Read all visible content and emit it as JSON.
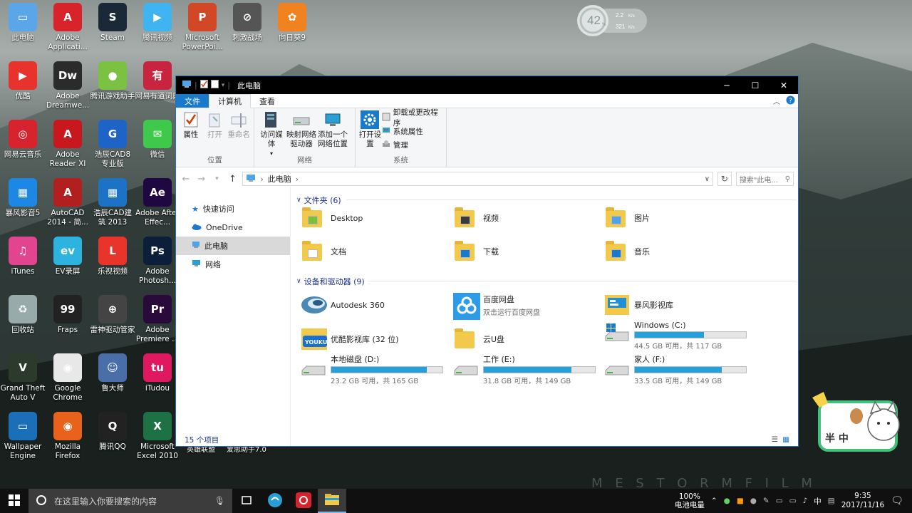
{
  "desktop": {
    "icons": [
      {
        "label": "此电脑"
      },
      {
        "label": "Adobe Applicati..."
      },
      {
        "label": "Steam"
      },
      {
        "label": "腾讯视频"
      },
      {
        "label": "Microsoft PowerPoi..."
      },
      {
        "label": "刺激战场"
      },
      {
        "label": "向日葵9"
      },
      {
        "label": "优酷"
      },
      {
        "label": "Adobe Dreamwe..."
      },
      {
        "label": "腾讯游戏助手"
      },
      {
        "label": "网易有道词典"
      },
      {
        "label": "网易云音乐"
      },
      {
        "label": "Adobe Reader XI"
      },
      {
        "label": "浩辰CAD8 专业版"
      },
      {
        "label": "微信"
      },
      {
        "label": "暴风影音5"
      },
      {
        "label": "AutoCAD 2014 - 简..."
      },
      {
        "label": "浩辰CAD建筑 2013"
      },
      {
        "label": "Adobe After Effec..."
      },
      {
        "label": "iTunes"
      },
      {
        "label": "EV录屏"
      },
      {
        "label": "乐视视频"
      },
      {
        "label": "Adobe Photosh..."
      },
      {
        "label": "回收站"
      },
      {
        "label": "Fraps"
      },
      {
        "label": "雷神驱动管家"
      },
      {
        "label": "Adobe Premiere ..."
      },
      {
        "label": "Grand Theft Auto V"
      },
      {
        "label": "Google Chrome"
      },
      {
        "label": "鲁大师"
      },
      {
        "label": "iTudou"
      },
      {
        "label": "Wallpaper Engine"
      },
      {
        "label": "Mozilla Firefox"
      },
      {
        "label": "腾讯QQ"
      },
      {
        "label": "Microsoft Excel 2010"
      }
    ],
    "hidden_labels": [
      "英雄联盟",
      "爱思助手7.0"
    ],
    "widget": {
      "cpu": "42",
      "cpu_unit": "%",
      "up": "2.2",
      "up_unit": "K/s",
      "down": "321",
      "down_unit": "K/s"
    },
    "mascot": {
      "text": "半 中"
    },
    "watermark": "M E S T O R M  F I L M"
  },
  "window": {
    "title": "此电脑",
    "controls": {
      "minimize": "─",
      "maximize": "☐",
      "close": "✕"
    }
  },
  "ribbon": {
    "tabs": [
      "文件",
      "计算机",
      "查看"
    ],
    "groups": {
      "location": {
        "name": "位置",
        "buttons": [
          {
            "label": "属性",
            "disabled": false
          },
          {
            "label": "打开",
            "disabled": true
          },
          {
            "label": "重命名",
            "disabled": true
          }
        ]
      },
      "network": {
        "name": "网络",
        "buttons": [
          {
            "label": "访问媒体"
          },
          {
            "label": "映射网络驱动器"
          },
          {
            "label": "添加一个网络位置"
          }
        ]
      },
      "system": {
        "name": "系统",
        "big": "打开设置",
        "small": [
          "卸载或更改程序",
          "系统属性",
          "管理"
        ]
      }
    }
  },
  "address": {
    "path": "此电脑",
    "search_placeholder": "搜索\"此电..."
  },
  "navpane": {
    "items": [
      "快速访问",
      "OneDrive",
      "此电脑",
      "网络"
    ]
  },
  "folders": {
    "header": "文件夹 (6)",
    "items": [
      "Desktop",
      "视频",
      "图片",
      "文档",
      "下载",
      "音乐"
    ]
  },
  "devices": {
    "header": "设备和驱动器 (9)",
    "apps": [
      {
        "name": "Autodesk 360",
        "sub": ""
      },
      {
        "name": "百度网盘",
        "sub": "双击运行百度网盘"
      },
      {
        "name": "暴风影视库",
        "sub": ""
      },
      {
        "name": "优酷影视库 (32 位)",
        "sub": ""
      },
      {
        "name": "云U盘",
        "sub": ""
      }
    ],
    "drives": [
      {
        "name": "Windows (C:)",
        "free": "44.5 GB 可用，共 117 GB",
        "used_fraction": 0.62
      },
      {
        "name": "本地磁盘 (D:)",
        "free": "23.2 GB 可用，共 165 GB",
        "used_fraction": 0.86
      },
      {
        "name": "工作 (E:)",
        "free": "31.8 GB 可用，共 149 GB",
        "used_fraction": 0.79
      },
      {
        "name": "家人 (F:)",
        "free": "33.5 GB 可用，共 149 GB",
        "used_fraction": 0.78
      }
    ]
  },
  "status": {
    "count": "15 个项目"
  },
  "taskbar": {
    "search_placeholder": "在这里输入你要搜索的内容",
    "battery_percent": "100%",
    "battery_label": "电池电量",
    "ime": "中",
    "time": "9:35",
    "date": "2017/11/16"
  },
  "colors": {
    "accent": "#1979ca",
    "drive_fill": "#26a0da",
    "taskbar": "#101010"
  }
}
